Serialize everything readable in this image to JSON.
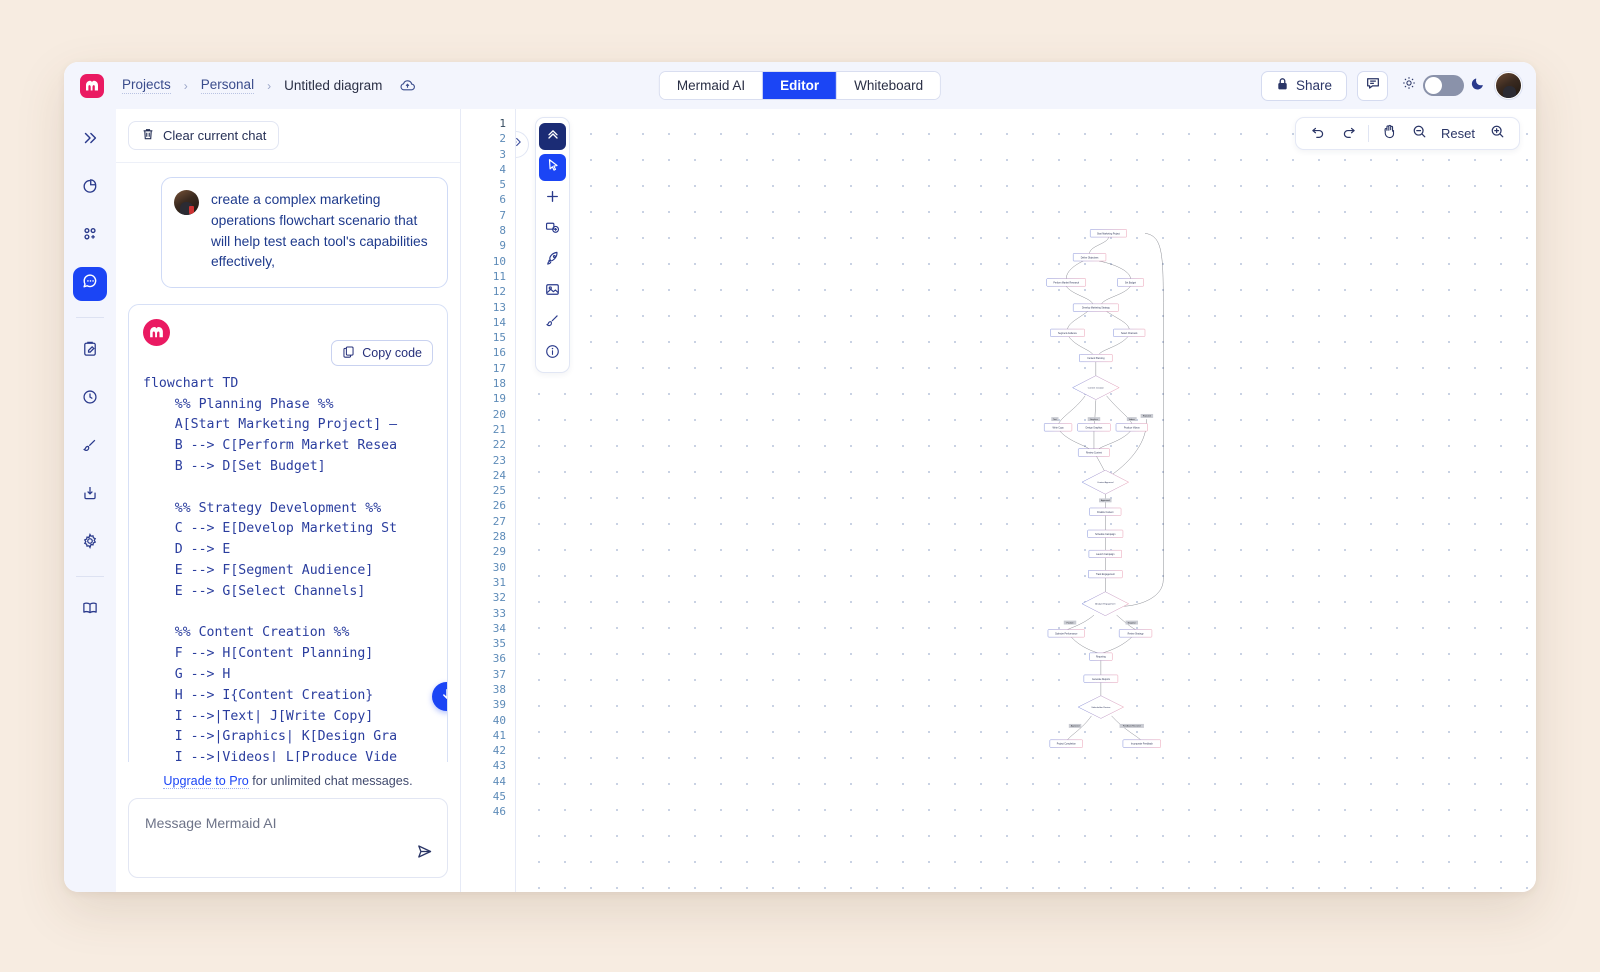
{
  "app": {
    "logo": "mermaid-logo",
    "breadcrumb": [
      "Projects",
      "Personal",
      "Untitled diagram"
    ],
    "cloud_icon": "cloud-sync-icon"
  },
  "tabs": [
    {
      "label": "Mermaid AI",
      "active": false
    },
    {
      "label": "Editor",
      "active": true
    },
    {
      "label": "Whiteboard",
      "active": false
    }
  ],
  "topbar": {
    "share_label": "Share",
    "share_icon": "lock-icon",
    "comment_icon": "comment-icon",
    "sun_icon": "sun-icon",
    "moon_icon": "moon-icon",
    "theme_toggle_state": "off",
    "avatar": "user-avatar"
  },
  "rail": {
    "items": [
      {
        "name": "expand-sidebar",
        "icon": "chevrons-right-icon",
        "active": false
      },
      {
        "name": "diagrams",
        "icon": "pie-chart-icon",
        "active": false
      },
      {
        "name": "add-shapes",
        "icon": "add-nodes-icon",
        "active": false
      },
      {
        "name": "ai-chat",
        "icon": "chat-bubble-icon",
        "active": true
      },
      {
        "name": "notes",
        "icon": "clipboard-edit-icon",
        "active": false
      },
      {
        "name": "history",
        "icon": "clock-icon",
        "active": false
      },
      {
        "name": "theme",
        "icon": "paintbrush-icon",
        "active": false
      },
      {
        "name": "export",
        "icon": "download-icon",
        "active": false
      },
      {
        "name": "settings",
        "icon": "gear-icon",
        "active": false
      },
      {
        "name": "docs",
        "icon": "book-icon",
        "active": false
      }
    ]
  },
  "chat": {
    "clear_label": "Clear current chat",
    "clear_icon": "trash-icon",
    "user_message": "create a complex marketing operations flowchart scenario that will help test each tool's capabilities effectively,",
    "copy_label": "Copy code",
    "copy_icon": "copy-icon",
    "code": "flowchart TD\n    %% Planning Phase %%\n    A[Start Marketing Project] —\n    B --> C[Perform Market Resea\n    B --> D[Set Budget]\n\n    %% Strategy Development %%\n    C --> E[Develop Marketing St\n    D --> E\n    E --> F[Segment Audience]\n    E --> G[Select Channels]\n\n    %% Content Creation %%\n    F --> H[Content Planning]\n    G --> H\n    H --> I{Content Creation}\n    I -->|Text| J[Write Copy]\n    I -->|Graphics| K[Design Gra\n    I -->|Videos| L[Produce Vide",
    "scroll_down_icon": "arrow-down-icon",
    "upgrade_link": "Upgrade to Pro",
    "upgrade_rest": " for unlimited chat messages.",
    "composer_placeholder": "Message Mermaid AI",
    "send_icon": "send-icon"
  },
  "editor": {
    "first_line": 1,
    "last_line": 46
  },
  "canvas": {
    "collapse_icon": "chevrons-right-icon",
    "tools": [
      {
        "name": "collapse-toolbar",
        "icon": "chevrons-up-icon",
        "style": "dark"
      },
      {
        "name": "select-tool",
        "icon": "cursor-icon",
        "style": "blue"
      },
      {
        "name": "add-tool",
        "icon": "plus-icon",
        "style": "plain"
      },
      {
        "name": "add-frame-tool",
        "icon": "frame-add-icon",
        "style": "plain"
      },
      {
        "name": "rocket-tool",
        "icon": "rocket-icon",
        "style": "plain"
      },
      {
        "name": "image-tool",
        "icon": "image-icon",
        "style": "plain"
      },
      {
        "name": "brush-tool",
        "icon": "paintbrush-icon",
        "style": "plain"
      },
      {
        "name": "info-tool",
        "icon": "info-icon",
        "style": "plain"
      }
    ],
    "controls": {
      "undo_icon": "undo-icon",
      "redo_icon": "redo-icon",
      "pan_icon": "hand-icon",
      "zoom_out_icon": "zoom-out-icon",
      "reset_label": "Reset",
      "zoom_in_icon": "zoom-in-icon"
    }
  },
  "diagram": {
    "type": "flowchart",
    "direction": "TD",
    "nodes": [
      {
        "id": "A",
        "label": "Start Marketing Project",
        "shape": "rect"
      },
      {
        "id": "B",
        "label": "Define Objectives",
        "shape": "rect"
      },
      {
        "id": "C",
        "label": "Perform Market Research",
        "shape": "rect"
      },
      {
        "id": "D",
        "label": "Set Budget",
        "shape": "rect"
      },
      {
        "id": "E",
        "label": "Develop Marketing Strategy",
        "shape": "rect"
      },
      {
        "id": "F",
        "label": "Segment Audience",
        "shape": "rect"
      },
      {
        "id": "G",
        "label": "Select Channels",
        "shape": "rect"
      },
      {
        "id": "H",
        "label": "Content Planning",
        "shape": "rect"
      },
      {
        "id": "I",
        "label": "Content Creation",
        "shape": "diamond"
      },
      {
        "id": "J",
        "label": "Write Copy",
        "shape": "rect"
      },
      {
        "id": "K",
        "label": "Design Graphics",
        "shape": "rect"
      },
      {
        "id": "L",
        "label": "Produce Videos",
        "shape": "rect"
      },
      {
        "id": "M",
        "label": "Review Content",
        "shape": "rect"
      },
      {
        "id": "N",
        "label": "Content Approval",
        "shape": "diamond"
      },
      {
        "id": "O",
        "label": "Finalize Content",
        "shape": "rect"
      },
      {
        "id": "P",
        "label": "Schedule Campaign",
        "shape": "rect"
      },
      {
        "id": "Q",
        "label": "Launch Campaign",
        "shape": "rect"
      },
      {
        "id": "R",
        "label": "Track Engagement",
        "shape": "rect"
      },
      {
        "id": "S",
        "label": "Analyze Engagement",
        "shape": "diamond"
      },
      {
        "id": "T",
        "label": "Optimize Performance",
        "shape": "rect"
      },
      {
        "id": "U",
        "label": "Revise Strategy",
        "shape": "rect"
      },
      {
        "id": "V",
        "label": "Reporting",
        "shape": "rect"
      },
      {
        "id": "W",
        "label": "Generate Reports",
        "shape": "rect"
      },
      {
        "id": "X",
        "label": "Stakeholder Review",
        "shape": "diamond"
      },
      {
        "id": "Y",
        "label": "Project Completion",
        "shape": "rect"
      },
      {
        "id": "Z",
        "label": "Incorporate Feedback",
        "shape": "rect"
      }
    ],
    "edge_labels": [
      "Text",
      "Graphics",
      "Videos",
      "Rejected",
      "Approved",
      "Positive",
      "Negative",
      "Approved",
      "Feedback Received"
    ]
  }
}
